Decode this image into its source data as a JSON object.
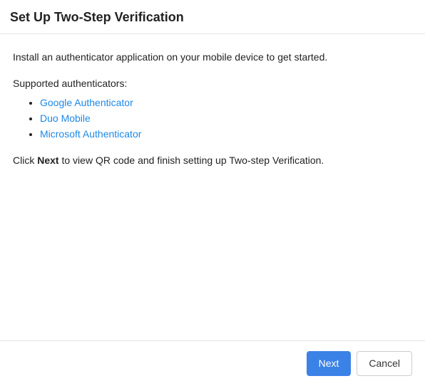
{
  "dialog": {
    "title": "Set Up Two-Step Verification"
  },
  "body": {
    "intro": "Install an authenticator application on your mobile device to get started.",
    "supported_label": "Supported authenticators:",
    "authenticators": [
      "Google Authenticator",
      "Duo Mobile",
      "Microsoft Authenticator"
    ],
    "instruction_prefix": "Click ",
    "instruction_bold": "Next",
    "instruction_suffix": " to view QR code and finish setting up Two-step Verification."
  },
  "footer": {
    "next_label": "Next",
    "cancel_label": "Cancel"
  }
}
